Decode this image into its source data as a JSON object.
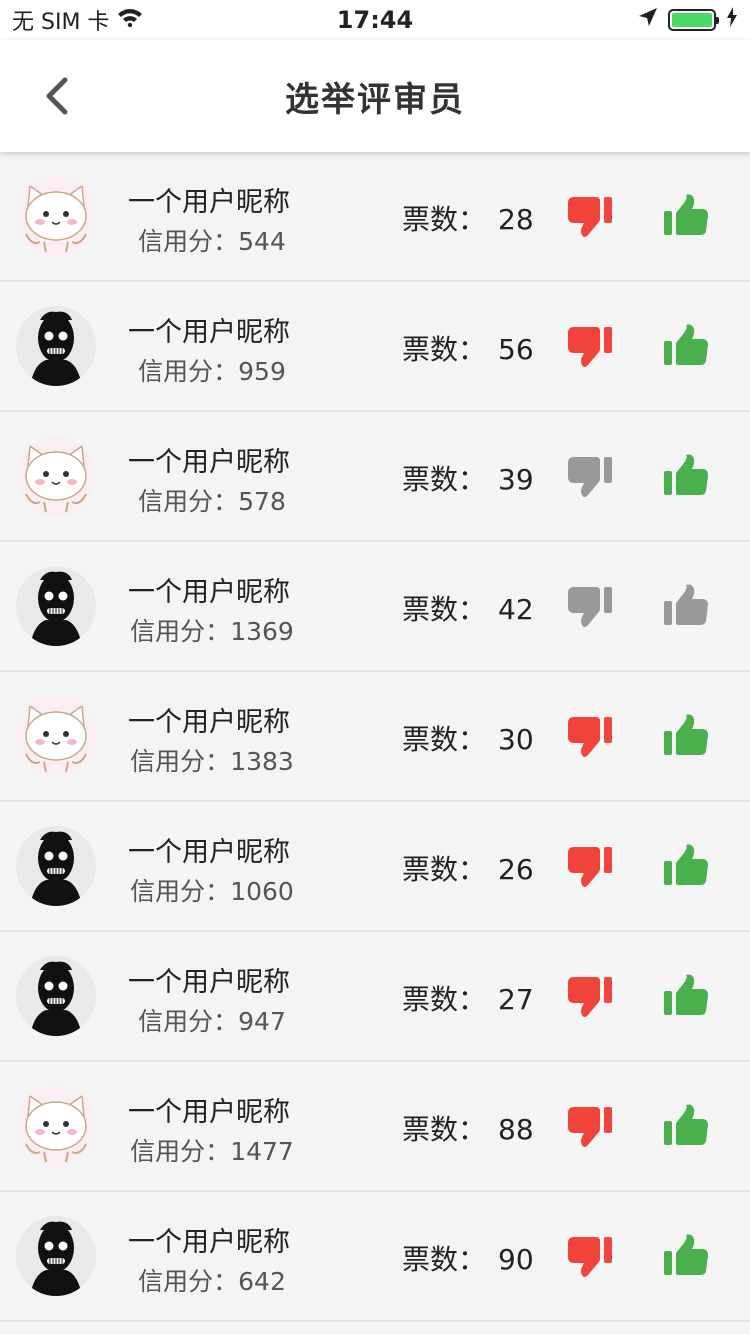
{
  "status_bar": {
    "carrier": "无 SIM 卡",
    "time": "17:44"
  },
  "nav": {
    "title": "选举评审员"
  },
  "labels": {
    "credit_prefix": "信用分：",
    "votes_prefix": "票数："
  },
  "colors": {
    "dislike_active": "#f0433a",
    "like_active": "#4aaf4d",
    "inactive": "#999999"
  },
  "rows": [
    {
      "avatar": "cat",
      "name": "一个用户昵称",
      "credit": "544",
      "votes": "28",
      "dislike_active": true,
      "like_active": true
    },
    {
      "avatar": "shadow",
      "name": "一个用户昵称",
      "credit": "959",
      "votes": "56",
      "dislike_active": true,
      "like_active": true
    },
    {
      "avatar": "cat",
      "name": "一个用户昵称",
      "credit": "578",
      "votes": "39",
      "dislike_active": false,
      "like_active": true
    },
    {
      "avatar": "shadow",
      "name": "一个用户昵称",
      "credit": "1369",
      "votes": "42",
      "dislike_active": false,
      "like_active": false
    },
    {
      "avatar": "cat",
      "name": "一个用户昵称",
      "credit": "1383",
      "votes": "30",
      "dislike_active": true,
      "like_active": true
    },
    {
      "avatar": "shadow",
      "name": "一个用户昵称",
      "credit": "1060",
      "votes": "26",
      "dislike_active": true,
      "like_active": true
    },
    {
      "avatar": "shadow",
      "name": "一个用户昵称",
      "credit": "947",
      "votes": "27",
      "dislike_active": true,
      "like_active": true
    },
    {
      "avatar": "cat",
      "name": "一个用户昵称",
      "credit": "1477",
      "votes": "88",
      "dislike_active": true,
      "like_active": true
    },
    {
      "avatar": "shadow",
      "name": "一个用户昵称",
      "credit": "642",
      "votes": "90",
      "dislike_active": true,
      "like_active": true
    }
  ]
}
